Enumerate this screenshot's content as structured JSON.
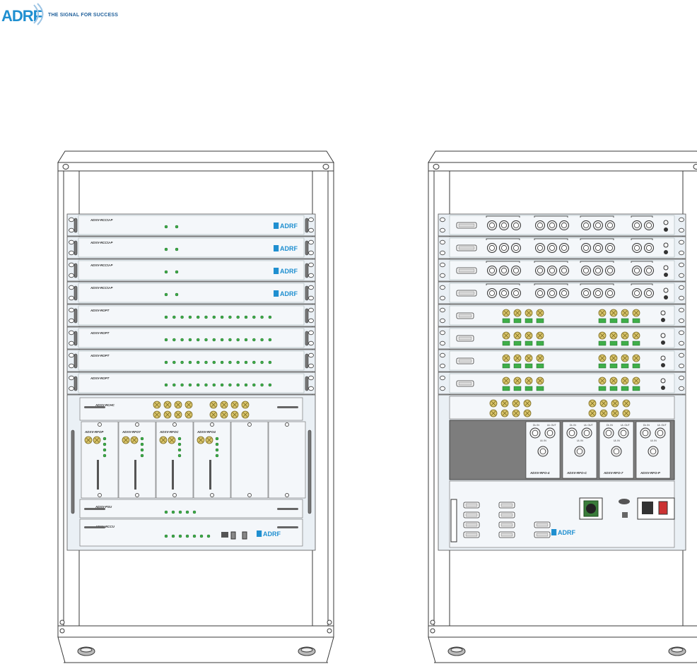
{
  "header": {
    "logo": "ADRF",
    "tagline": "THE SIGNAL FOR SUCCESS"
  },
  "colors": {
    "frame": "#3a3a3a",
    "panel": "#eaf0f5",
    "port_gold": "#d8c36a",
    "led_green": "#3fae49",
    "brand_blue": "#1f8fd0",
    "dark_block": "#7d7d7d"
  },
  "front_rack": {
    "units": [
      {
        "model": "ADXV-RCCU-P",
        "type": "rcu"
      },
      {
        "model": "ADXV-RCCU-P",
        "type": "rcu"
      },
      {
        "model": "ADXV-RCCU-P",
        "type": "rcu"
      },
      {
        "model": "ADXV-RCCU-P",
        "type": "rcu"
      },
      {
        "model": "ADXV-ROPT",
        "type": "opt"
      },
      {
        "model": "ADXV-ROPT",
        "type": "opt"
      },
      {
        "model": "ADXV-ROPT",
        "type": "opt"
      },
      {
        "model": "ADXV-ROPT",
        "type": "opt"
      }
    ],
    "chassis": {
      "combiner_model": "ADXV-RCHC",
      "cards": [
        "ADXV-RFOP",
        "ADXV-RFO7",
        "ADXV-RFOC",
        "ADXV-RFO4"
      ],
      "psu_model": "ADXV-PSU",
      "ctrl_model": "ADXV-RCCU"
    }
  },
  "rear_rack": {
    "rf_units": 4,
    "opt_units": 4,
    "module_models": [
      "ADXV-RFO-4",
      "ADXV-RFO-C",
      "ADXV-RFO-7",
      "ADXV-RFO-P"
    ],
    "module_ports": [
      "DL IN",
      "UL OUT",
      "UL IN"
    ]
  }
}
